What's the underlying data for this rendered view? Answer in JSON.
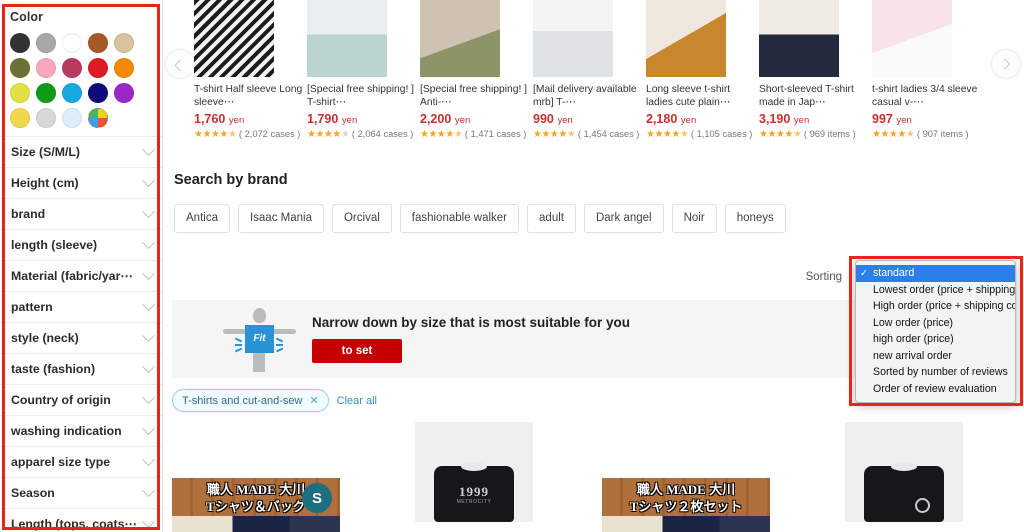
{
  "sidebar": {
    "color_section_title": "Color",
    "swatches": [
      {
        "name": "black",
        "hex": "#333333"
      },
      {
        "name": "gray",
        "hex": "#a8a8a8"
      },
      {
        "name": "white",
        "hex": "#ffffff"
      },
      {
        "name": "brown",
        "hex": "#a65a25"
      },
      {
        "name": "beige",
        "hex": "#d8c3a0"
      },
      {
        "name": "khaki",
        "hex": "#6d7034"
      },
      {
        "name": "pink",
        "hex": "#f7a8bd"
      },
      {
        "name": "rose",
        "hex": "#b83a5e"
      },
      {
        "name": "red",
        "hex": "#e01b22"
      },
      {
        "name": "orange",
        "hex": "#f58a00"
      },
      {
        "name": "yellow-green",
        "hex": "#e2e044"
      },
      {
        "name": "green",
        "hex": "#0f9b18"
      },
      {
        "name": "light-blue",
        "hex": "#17a8dd"
      },
      {
        "name": "navy",
        "hex": "#100b7a"
      },
      {
        "name": "purple",
        "hex": "#9b27c9"
      },
      {
        "name": "gold",
        "hex": "#f0d74b"
      },
      {
        "name": "silver",
        "hex": "#d8d8d8"
      },
      {
        "name": "pale-blue",
        "hex": "#ddeefb"
      },
      {
        "name": "multicolor",
        "hex": "multi"
      }
    ],
    "facets": [
      {
        "label": "Size (S/M/L)"
      },
      {
        "label": "Height (cm)"
      },
      {
        "label": "brand"
      },
      {
        "label": "length (sleeve)"
      },
      {
        "label": "Material (fabric/yar⋯"
      },
      {
        "label": "pattern"
      },
      {
        "label": "style (neck)"
      },
      {
        "label": "taste (fashion)"
      },
      {
        "label": "Country of origin"
      },
      {
        "label": "washing indication"
      },
      {
        "label": "apparel size type"
      },
      {
        "label": "Season"
      },
      {
        "label": "Length (tops, coats⋯"
      }
    ]
  },
  "carousel": {
    "prev_label": "‹",
    "next_label": "›",
    "products": [
      {
        "title": "T-shirt Half sleeve Long sleeve⋯",
        "price": "1,760",
        "currency": "yen",
        "stars": 4.5,
        "review_count": "2,072",
        "review_unit": "cases"
      },
      {
        "title": "[Special free shipping! ] T-shirt⋯",
        "price": "1,790",
        "currency": "yen",
        "stars": 4,
        "review_count": "2,064",
        "review_unit": "cases"
      },
      {
        "title": "[Special free shipping! ] Anti-⋯",
        "price": "2,200",
        "currency": "yen",
        "stars": 4.5,
        "review_count": "1,471",
        "review_unit": "cases"
      },
      {
        "title": "[Mail delivery available mrb] T-⋯",
        "price": "990",
        "currency": "yen",
        "stars": 4.5,
        "review_count": "1,454",
        "review_unit": "cases"
      },
      {
        "title": "Long sleeve t-shirt ladies cute plain⋯",
        "price": "2,180",
        "currency": "yen",
        "stars": 4.5,
        "review_count": "1,105",
        "review_unit": "cases"
      },
      {
        "title": "Short-sleeved T-shirt made in Jap⋯",
        "price": "3,190",
        "currency": "yen",
        "stars": 4.5,
        "review_count": "969",
        "review_unit": "items"
      },
      {
        "title": "t-shirt ladies 3/4 sleeve casual v-⋯",
        "price": "997",
        "currency": "yen",
        "stars": 4.5,
        "review_count": "907",
        "review_unit": "items"
      }
    ]
  },
  "brand_section": {
    "title": "Search by brand",
    "brands": [
      "Antica",
      "Isaac Mania",
      "Orcival",
      "fashionable walker",
      "adult",
      "Dark angel",
      "Noir",
      "honeys"
    ]
  },
  "sorting": {
    "label": "Sorting",
    "selected": "standard",
    "options": [
      {
        "label": "standard",
        "selected": true
      },
      {
        "label": "Lowest order (price + shipping)",
        "selected": false
      },
      {
        "label": "High order (price + shipping cost)",
        "selected": false
      },
      {
        "label": "Low order (price)",
        "selected": false
      },
      {
        "label": "high order (price)",
        "selected": false
      },
      {
        "label": "new arrival order",
        "selected": false
      },
      {
        "label": "Sorted by number of reviews",
        "selected": false
      },
      {
        "label": "Order of review evaluation",
        "selected": false
      }
    ],
    "check_glyph": "✓"
  },
  "fit_banner": {
    "headline": "Narrow down by size that is most suitable for you",
    "button_label": "to set",
    "figure_label": "Fit"
  },
  "filters": {
    "tags": [
      {
        "label": "T-shirts and cut-and-sew",
        "remove_glyph": "✕"
      }
    ],
    "clear_all_label": "Clear all"
  },
  "bottom_products": [
    {
      "kind": "wood-banner",
      "line1": "職人 MADE 大川",
      "line2": "Tシャツ＆バッグ",
      "badge": "S"
    },
    {
      "kind": "gray-tee",
      "logo": "1999",
      "sublogo": "METROCITY"
    },
    {
      "kind": "wood-banner",
      "line1": "職人 MADE 大川",
      "line2": "Tシャツ２枚セット",
      "badge": ""
    },
    {
      "kind": "gray-tee",
      "logo": "",
      "sublogo": ""
    }
  ],
  "accent_colors": {
    "highlight_border": "#e8241b",
    "price_red": "#c9302c",
    "star_gold": "#f5a623",
    "dropdown_selected": "#2a7fe8",
    "cta_red": "#c40000"
  }
}
